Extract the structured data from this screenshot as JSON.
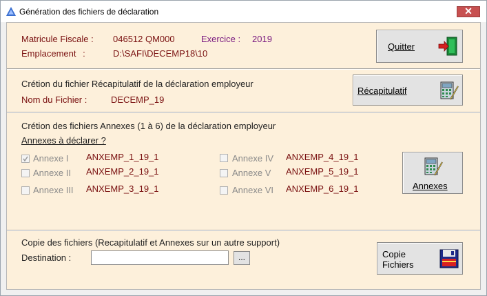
{
  "window": {
    "title": "Génération des fichiers de déclaration",
    "close_glyph": "✕"
  },
  "header": {
    "matricule_label": "Matricule Fiscale :",
    "matricule_value": "046512 QM000",
    "exercice_label": "Exercice :",
    "exercice_value": "2019",
    "emplacement_label": "Emplacement :",
    "emplacement_value": "D:\\SAFI\\DECEMP18\\10",
    "quit_button": "Quitter"
  },
  "recap": {
    "heading": "Crétion du fichier Récapitulatif de la déclaration employeur",
    "file_label": "Nom du Fichier :",
    "file_value": "DECEMP_19",
    "button": "Récapitulatif"
  },
  "annexes": {
    "heading": "Crétion des fichiers Annexes (1 à 6)  de la déclaration employeur",
    "subheading": "Annexes à déclarer ?",
    "items": [
      {
        "label": "Annexe I",
        "file": "ANXEMP_1_19_1",
        "checked": true
      },
      {
        "label": "Annexe II",
        "file": "ANXEMP_2_19_1",
        "checked": false
      },
      {
        "label": "Annexe III",
        "file": "ANXEMP_3_19_1",
        "checked": false
      },
      {
        "label": "Annexe IV",
        "file": "ANXEMP_4_19_1",
        "checked": false
      },
      {
        "label": "Annexe V",
        "file": "ANXEMP_5_19_1",
        "checked": false
      },
      {
        "label": "Annexe VI",
        "file": "ANXEMP_6_19_1",
        "checked": false
      }
    ],
    "button": "Annexes"
  },
  "copy": {
    "heading": "Copie des fichiers (Recapitulatif et Annexes sur un autre support)",
    "destination_label": "Destination :",
    "destination_value": "",
    "browse_label": "...",
    "button_line1": "Copie",
    "button_line2": "Fichiers"
  },
  "colors": {
    "panel_background": "#fdf0db",
    "value_text": "#7a1111",
    "exercice_text": "#7a1a80"
  }
}
